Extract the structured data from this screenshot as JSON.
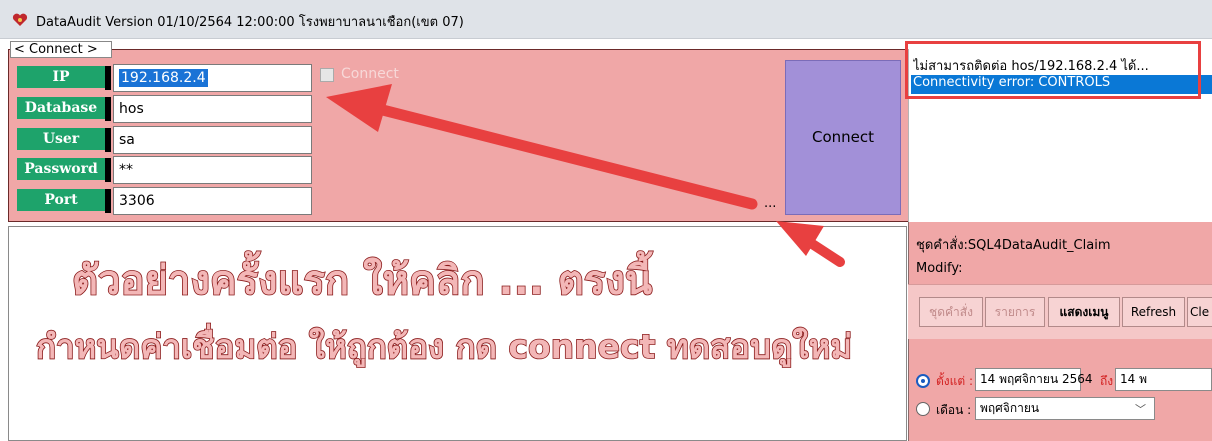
{
  "window": {
    "title": "DataAudit Version 01/10/2564 12:00:00 โรงพยาบาลนาเชือก(เขต 07)",
    "app_icon": "heart-icon"
  },
  "connect": {
    "legend": "< Connect >",
    "fields": [
      {
        "label": "IP",
        "value": "192.168.2.4"
      },
      {
        "label": "Database",
        "value": "hos"
      },
      {
        "label": "User",
        "value": "sa"
      },
      {
        "label": "Password",
        "value": "**"
      },
      {
        "label": "Port",
        "value": "3306"
      }
    ],
    "checkbox_label": "Connect",
    "button_label": "Connect",
    "ellipsis_label": "..."
  },
  "log": {
    "lines": [
      "ไม่สามารถติดต่อ hos/192.168.2.4 ได้...",
      "Connectivity error: CONTROLS"
    ]
  },
  "right_panel": {
    "cmdset": "ชุดคำสั่ง:SQL4DataAudit_Claim",
    "modify": "Modify:",
    "buttons": [
      "ชุดคำสั่ง",
      "รายการ",
      "แสดงเมนู",
      "Refresh",
      "Cle"
    ],
    "from_label": "ตั้งแต่ :",
    "from_value": "14 พฤศจิกายน 2564",
    "to_label": "ถึง",
    "to_value": "14 พ",
    "month_label": "เดือน :",
    "month_value": "พฤศจิกายน"
  },
  "annotation": {
    "line1": "ตัวอย่างครั้งแรก ให้คลิก ... ตรงนี้",
    "line2": "กำหนดค่าเชื่อมต่อ ให้ถูกต้อง กด connect ทดสอบดูใหม่"
  },
  "colors": {
    "panel_pink": "#f0a7a7",
    "label_green": "#1ea36b",
    "button_purple": "#a290d8",
    "selection_blue": "#0a78d6",
    "arrow_red": "#e84040"
  }
}
